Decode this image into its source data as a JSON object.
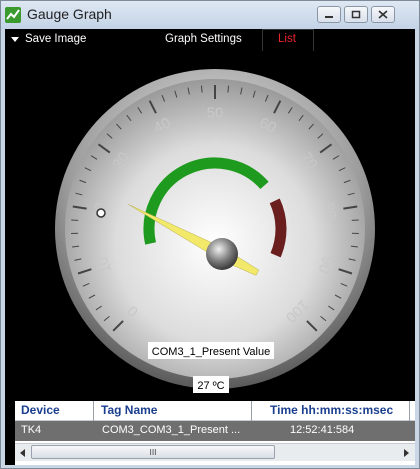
{
  "window": {
    "title": "Gauge Graph"
  },
  "menu": {
    "save_image": "Save Image",
    "graph_settings": "Graph Settings",
    "list": "List"
  },
  "gauge": {
    "min": 0,
    "max": 100,
    "ticks": [
      "0",
      "10",
      "20",
      "30",
      "40",
      "50",
      "60",
      "70",
      "80",
      "90",
      "100"
    ],
    "tag_label": "COM3_1_Present Value",
    "value_label": "27 ºC",
    "value": 27,
    "colors": {
      "needle": "#f2e86a",
      "green_band": "#1e9b1e",
      "red_band": "#6a1e1e"
    }
  },
  "table": {
    "headers": {
      "device": "Device",
      "tag_name": "Tag Name",
      "time": "Time hh:mm:ss:msec"
    },
    "rows": [
      {
        "device": "TK4",
        "tag_name": "COM3_COM3_1_Present ...",
        "time": "12:52:41:584"
      }
    ],
    "thumb_grip": "III"
  }
}
